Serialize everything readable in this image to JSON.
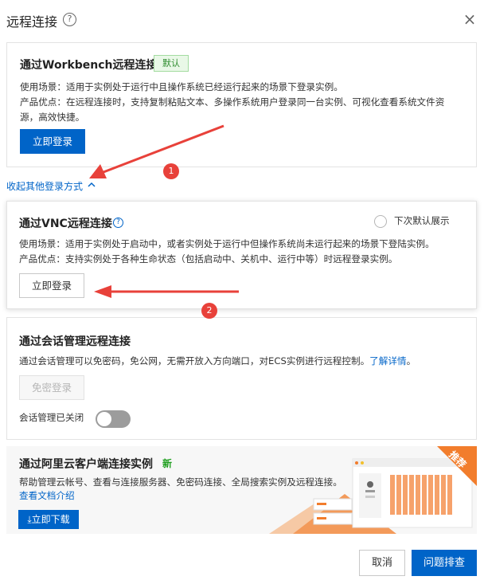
{
  "dialog": {
    "title": "远程连接",
    "help_icon": "?",
    "close_icon": "×"
  },
  "workbench": {
    "title": "通过Workbench远程连接",
    "tag": "默认",
    "desc_line1": "使用场景：适用于实例处于运行中且操作系统已经运行起来的场景下登录实例。",
    "desc_line2": "产品优点：在远程连接时，支持复制粘贴文本、多操作系统用户登录同一台实例、可视化查看系统文件资",
    "desc_line3": "源，高效快捷。",
    "button": "立即登录"
  },
  "collapse_link": "收起其他登录方式",
  "vnc": {
    "title": "通过VNC远程连接",
    "info_icon": "?",
    "default_radio_label": "下次默认展示",
    "desc_line1": "使用场景：适用于实例处于启动中，或者实例处于运行中但操作系统尚未运行起来的场景下登陆实例。",
    "desc_line2": "产品优点：支持实例处于各种生命状态（包括启动中、关机中、运行中等）时远程登录实例。",
    "button": "立即登录"
  },
  "session": {
    "title": "通过会话管理远程连接",
    "desc": "通过会话管理可以免密码，免公网，无需开放入方向端口，对ECS实例进行远程控制。",
    "learn_more": "了解详情",
    "learn_more_suffix": "。",
    "button": "免密登录",
    "toggle_label": "会话管理已关闭",
    "toggle_on": false
  },
  "client": {
    "title": "通过阿里云客户端连接实例",
    "new_tag": "新",
    "desc": "帮助管理云帐号、查看与连接服务器、免密码连接、全局搜索实例及远程连接。",
    "doc_link": "查看文档介绍",
    "download_button": "立即下载",
    "ribbon": "推荐"
  },
  "annotations": {
    "marker1": "1",
    "marker2": "2"
  },
  "footer": {
    "cancel": "取消",
    "troubleshoot": "问题排查"
  },
  "colors": {
    "primary": "#0064c8",
    "annotation_red": "#e8413a",
    "tag_green": "#2e8b2e",
    "promo_orange": "#f27d2c"
  }
}
